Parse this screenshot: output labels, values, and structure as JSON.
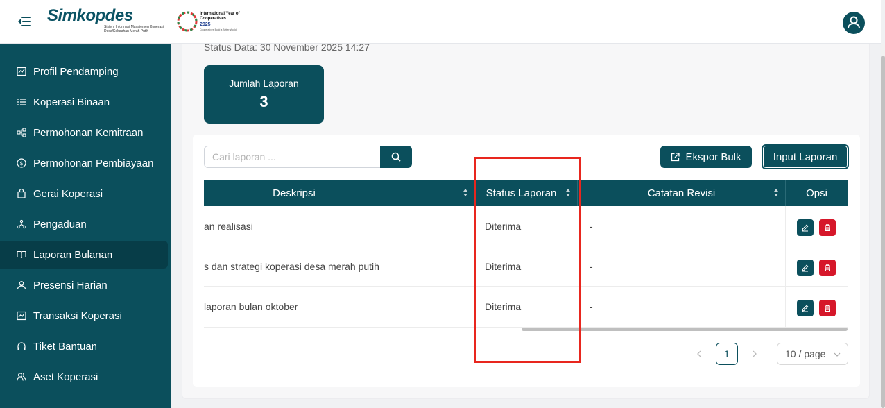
{
  "header": {
    "brand_name": "Simkopdes",
    "brand_subtitle": "Sistem Informasi Manajemen Koperasi Desa/Kelurahan Merah Putih",
    "iyc_title": "International Year of Cooperatives",
    "iyc_year": "2025",
    "iyc_tagline": "Cooperatives Build a Better World"
  },
  "sidebar": {
    "items": [
      {
        "label": "Profil Pendamping",
        "icon": "chart-line-icon"
      },
      {
        "label": "Koperasi Binaan",
        "icon": "list-icon"
      },
      {
        "label": "Permohonan Kemitraan",
        "icon": "network-icon"
      },
      {
        "label": "Permohonan Pembiayaan",
        "icon": "dollar-circle-icon"
      },
      {
        "label": "Gerai Koperasi",
        "icon": "shopping-bag-icon"
      },
      {
        "label": "Pengaduan",
        "icon": "nodes-icon"
      },
      {
        "label": "Laporan Bulanan",
        "icon": "book-open-icon",
        "active": true
      },
      {
        "label": "Presensi Harian",
        "icon": "user-icon"
      },
      {
        "label": "Transaksi Koperasi",
        "icon": "chart-line-icon"
      },
      {
        "label": "Tiket Bantuan",
        "icon": "headphones-icon"
      },
      {
        "label": "Aset Koperasi",
        "icon": "users-icon"
      }
    ]
  },
  "main": {
    "status_data": "Status Data: 30 November 2025 14:27",
    "count_card": {
      "label": "Jumlah Laporan",
      "value": "3"
    },
    "search": {
      "placeholder": "Cari laporan ..."
    },
    "buttons": {
      "export": "Ekspor Bulk",
      "input": "Input Laporan"
    },
    "table": {
      "columns": [
        "Deskripsi",
        "Status Laporan",
        "Catatan Revisi",
        "Opsi"
      ],
      "rows": [
        {
          "deskripsi": "an realisasi",
          "status": "Diterima",
          "catatan": "-"
        },
        {
          "deskripsi": "s dan strategi koperasi desa merah putih",
          "status": "Diterima",
          "catatan": "-"
        },
        {
          "deskripsi": "laporan bulan oktober",
          "status": "Diterima",
          "catatan": "-"
        }
      ]
    },
    "pagination": {
      "current": "1",
      "page_size": "10 / page"
    }
  },
  "colors": {
    "brand": "#0b4f5c",
    "danger": "#d6172a",
    "highlight": "#e8261e"
  }
}
